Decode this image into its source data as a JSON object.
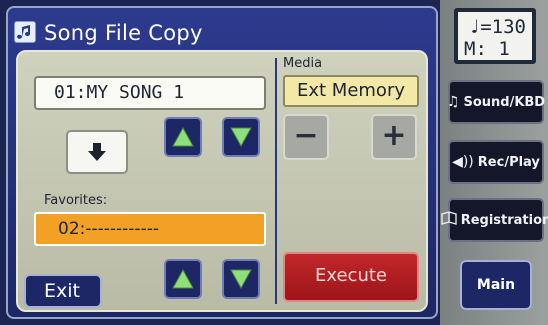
{
  "dialog": {
    "title": "Song File Copy",
    "icon": "song-file-icon"
  },
  "source": {
    "song_value": "01:MY SONG 1"
  },
  "favorites": {
    "label": "Favorites:",
    "value": "02:------------"
  },
  "media": {
    "label": "Media",
    "value": "Ext Memory",
    "minus": "−",
    "plus": "+"
  },
  "actions": {
    "execute": "Execute",
    "exit": "Exit"
  },
  "tempo": {
    "line1": "♩=130",
    "line2": "M:  1"
  },
  "side_buttons": {
    "sound_kbd": "Sound/KBD",
    "rec_play": "Rec/Play",
    "registration": "Registration",
    "main": "Main"
  },
  "colors": {
    "accent_orange": "#f3a126",
    "execute_red": "#c2262a",
    "navy": "#1d2766",
    "arrow_green": "#8fe07a"
  }
}
